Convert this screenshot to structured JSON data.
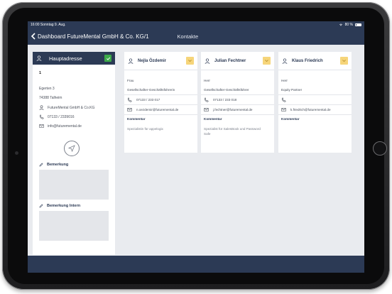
{
  "statusbar": {
    "time_date": "16:00  Sonntag 9. Aug.",
    "battery": "80 %"
  },
  "navbar": {
    "back_label": "Dashboard FutureMental GmbH & Co. KG/1",
    "title": "Kontakte"
  },
  "address": {
    "header": "Hauptadresse",
    "number": "1",
    "street": "Egerten 3",
    "city": "74388 Talheim",
    "company": "FutureMental GmbH & Co.KG",
    "phone": "07133 / 2339016",
    "email": "info@futuremental.de",
    "remark_label": "Bemerkung",
    "remark_value": "",
    "remark_intern_label": "Bemerkung Intern",
    "remark_intern_value": ""
  },
  "contacts": [
    {
      "name": "Nejla Özdemir",
      "salutation": "Frau",
      "role": "Gesellschafter-Geschäftsführerin",
      "phone": "07133 / 233 017",
      "email": "n.oezdemir@futuremental.de",
      "comment_label": "Kommentar",
      "comment": "Spezialistin für appelogix"
    },
    {
      "name": "Julian Fechtner",
      "salutation": "Herr",
      "role": "Gesellschafter-Geschäftsführer",
      "phone": "07133 / 233 018",
      "email": "j.fechtner@futuremental.de",
      "comment_label": "Kommentar",
      "comment": "Spezialist für SalesBook und Password Safe"
    },
    {
      "name": "Klaus Friedrich",
      "salutation": "Herr",
      "role": "Equity Partner",
      "phone": "",
      "email": "k.friedrich@futuremental.de",
      "comment_label": "Kommentar",
      "comment": ""
    }
  ],
  "colors": {
    "nav_bg": "#2c3a55",
    "accent_green": "#3daa4a",
    "accent_yellow": "#f6d57a",
    "page_bg": "#e9ebef"
  }
}
